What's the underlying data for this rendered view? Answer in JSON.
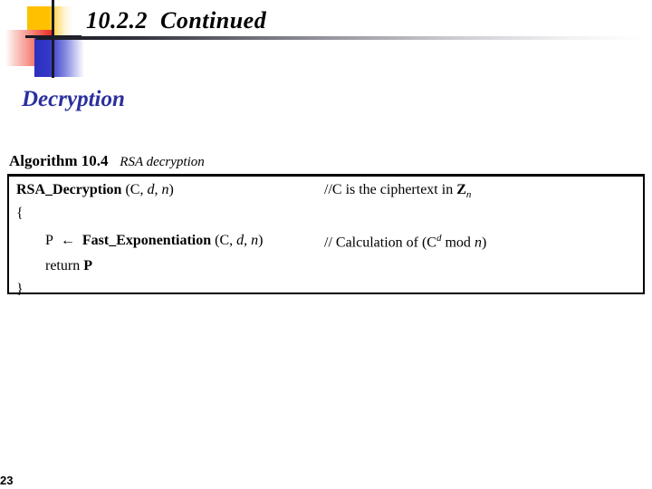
{
  "slide": {
    "title": "10.2.2  Continued",
    "section_heading": "Decryption",
    "page_number": "23",
    "accent_colors": {
      "heading_blue": "#2B2F9E",
      "logo_yellow": "#FFC000",
      "logo_red": "#E8332A",
      "logo_blue": "#2B2FBE",
      "rule_dark": "#1a1a24"
    }
  },
  "algorithm": {
    "caption_label": "Algorithm 10.4",
    "caption_title": "RSA decryption",
    "lines": [
      {
        "code": "RSA_Decryption",
        "code_args": " (C, d, n)",
        "comment_prefix": "//C is the ciphertext in ",
        "comment_symbol": "Z",
        "comment_subscript": "n"
      },
      {
        "code": "{"
      },
      {
        "indent_var": "P",
        "arrow": "←",
        "code": "Fast_Exponentiation",
        "code_args": " (C, d, n)",
        "comment_prefix": "// Calculation of (C",
        "comment_superscript": "d",
        "comment_suffix": " mod n)"
      },
      {
        "code": "return P"
      },
      {
        "code": "}"
      }
    ]
  }
}
